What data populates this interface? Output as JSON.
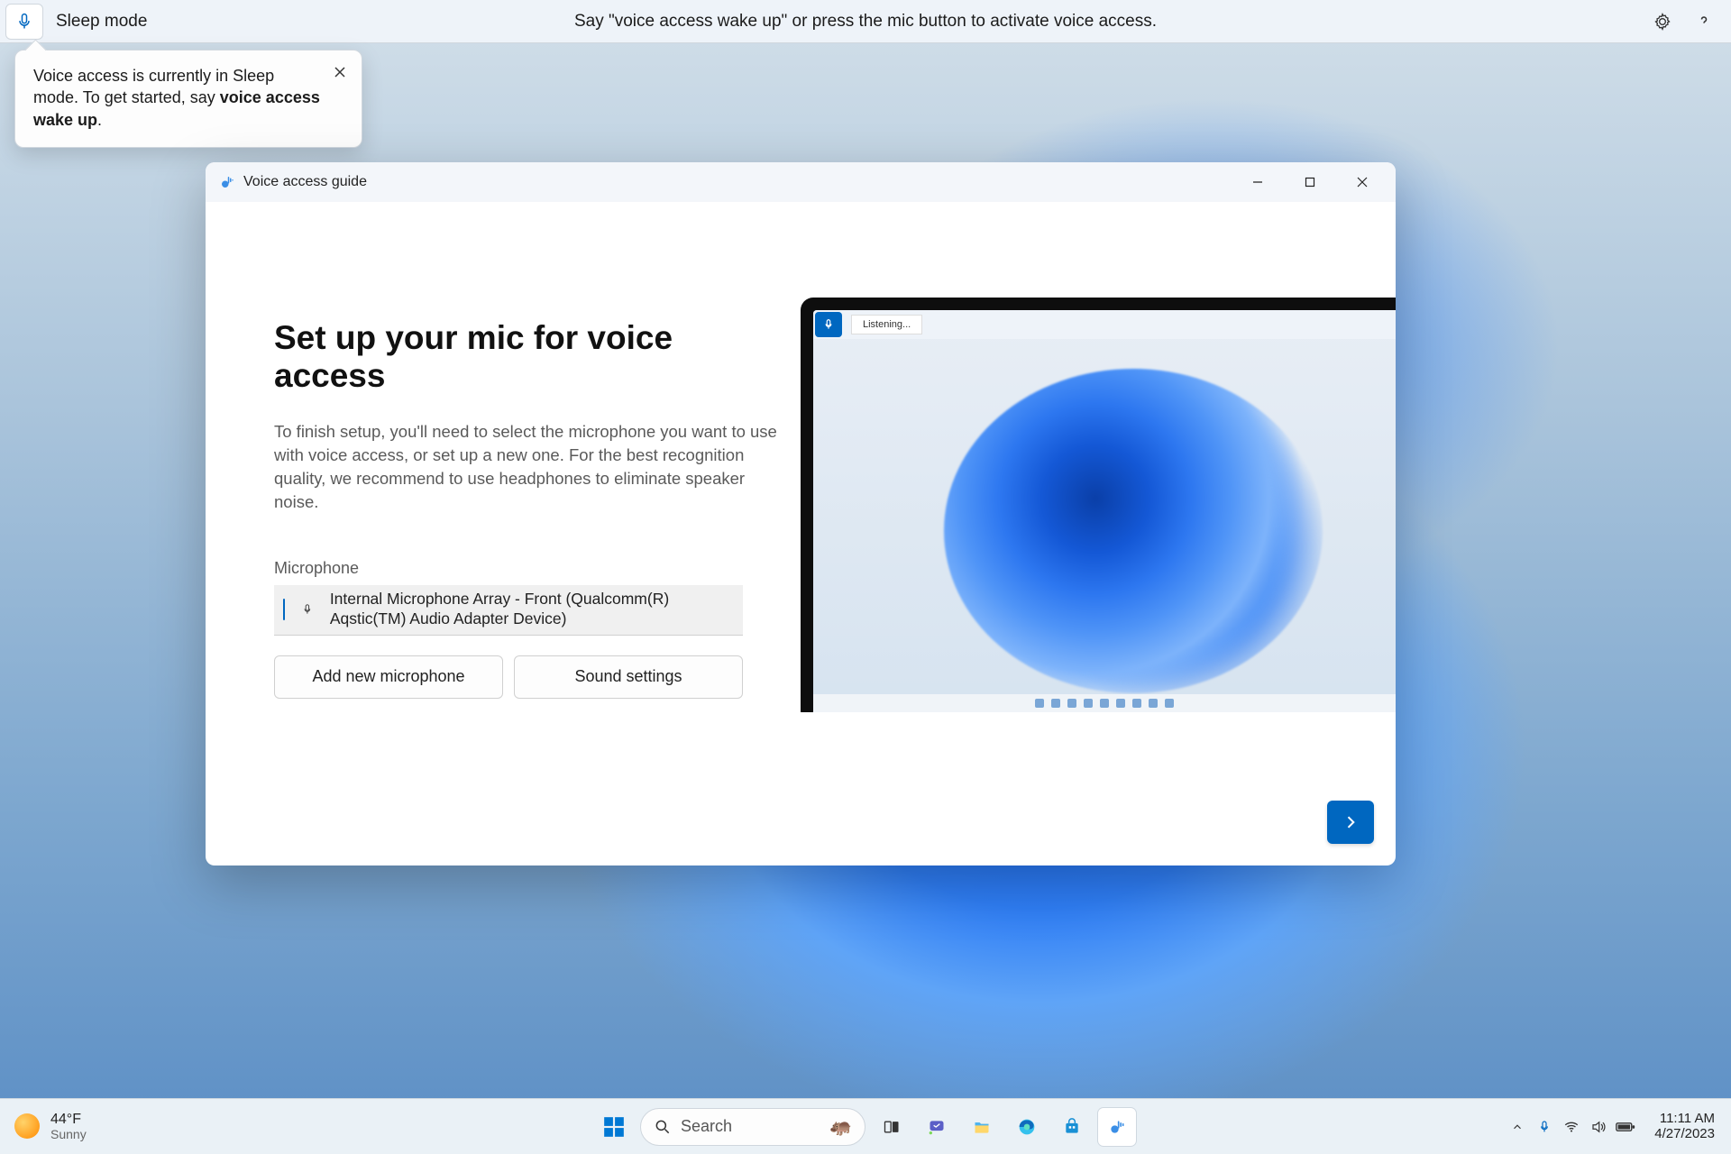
{
  "voice_bar": {
    "status": "Sleep mode",
    "hint": "Say \"voice access wake up\" or press the mic button to activate voice access."
  },
  "tooltip": {
    "line1": "Voice access is currently in Sleep mode. To get started, say ",
    "bold": "voice access wake up",
    "line2": "."
  },
  "window": {
    "title": "Voice access guide",
    "heading": "Set up your mic for voice access",
    "paragraph": "To finish setup, you'll need to select the microphone you want to use with voice access, or set up a new one. For the best recognition quality, we recommend to use headphones to eliminate speaker noise.",
    "mic_label": "Microphone",
    "mic_name": "Internal Microphone Array - Front (Qualcomm(R) Aqstic(TM) Audio Adapter Device)",
    "add_btn": "Add new microphone",
    "sound_btn": "Sound settings",
    "illus_listening": "Listening..."
  },
  "taskbar": {
    "temp": "44°F",
    "cond": "Sunny",
    "search": "Search",
    "time": "11:11 AM",
    "date": "4/27/2023"
  }
}
